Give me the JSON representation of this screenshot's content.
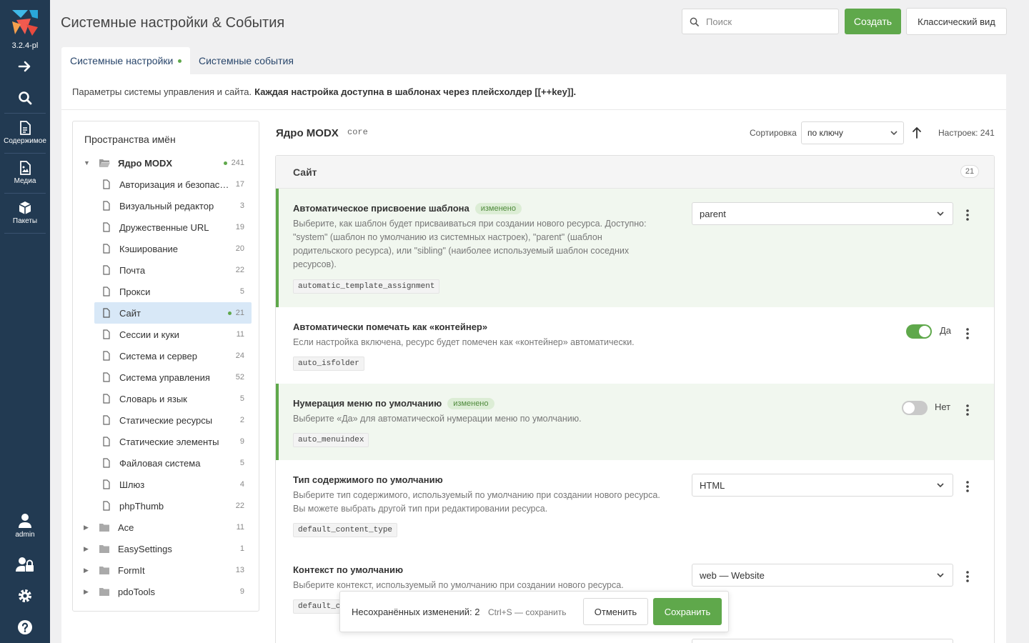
{
  "app": {
    "version": "3.2.4-pl",
    "brand_colors": {
      "sidebar": "#223a52",
      "accent": "#5fa84b",
      "link": "#29466b"
    }
  },
  "sidebar": {
    "items": [
      {
        "icon": "arrow-right-icon",
        "label": ""
      },
      {
        "icon": "search-icon",
        "label": ""
      },
      {
        "icon": "document-icon",
        "label": "Содержимое"
      },
      {
        "icon": "image-file-icon",
        "label": "Медиа"
      },
      {
        "icon": "package-icon",
        "label": "Пакеты"
      }
    ],
    "bottom": [
      {
        "icon": "user-icon",
        "label": "admin"
      },
      {
        "icon": "user-lock-icon",
        "label": ""
      },
      {
        "icon": "gear-icon",
        "label": ""
      },
      {
        "icon": "help-icon",
        "label": ""
      }
    ]
  },
  "header": {
    "title": "Системные настройки & События",
    "search_placeholder": "Поиск",
    "create_label": "Создать",
    "classic_label": "Классический вид"
  },
  "tabs": [
    {
      "label": "Системные настройки",
      "active": true,
      "modified": true
    },
    {
      "label": "Системные события",
      "active": false
    }
  ],
  "description": {
    "text": "Параметры системы управления и сайта.",
    "bold": "Каждая настройка доступна в шаблонах через плейсхолдер [[++key]]."
  },
  "namespaces": {
    "title": "Пространства имён",
    "root": {
      "label": "Ядро MODX",
      "count": "241",
      "modified": true,
      "expanded": true
    },
    "children": [
      {
        "label": "Авторизация и безопасность",
        "count": "17"
      },
      {
        "label": "Визуальный редактор",
        "count": "3"
      },
      {
        "label": "Дружественные URL",
        "count": "19"
      },
      {
        "label": "Кэширование",
        "count": "20"
      },
      {
        "label": "Почта",
        "count": "22"
      },
      {
        "label": "Прокси",
        "count": "5"
      },
      {
        "label": "Сайт",
        "count": "21",
        "selected": true,
        "modified": true
      },
      {
        "label": "Сессии и куки",
        "count": "11"
      },
      {
        "label": "Система и сервер",
        "count": "24"
      },
      {
        "label": "Система управления",
        "count": "52"
      },
      {
        "label": "Словарь и язык",
        "count": "5"
      },
      {
        "label": "Статические ресурсы",
        "count": "2"
      },
      {
        "label": "Статические элементы",
        "count": "9"
      },
      {
        "label": "Файловая система",
        "count": "5"
      },
      {
        "label": "Шлюз",
        "count": "4"
      },
      {
        "label": "phpThumb",
        "count": "22"
      }
    ],
    "others": [
      {
        "label": "Ace",
        "count": "11"
      },
      {
        "label": "EasySettings",
        "count": "1"
      },
      {
        "label": "FormIt",
        "count": "13"
      },
      {
        "label": "pdoTools",
        "count": "9"
      }
    ]
  },
  "content": {
    "title": "Ядро MODX",
    "key": "core",
    "sort_label": "Сортировка",
    "sort_value": "по ключу",
    "count_label": "Настроек: 241",
    "group": {
      "title": "Сайт",
      "count": "21"
    },
    "changed_badge": "изменено",
    "settings": [
      {
        "title": "Автоматическое присвоение шаблона",
        "changed": true,
        "desc": "Выберите, как шаблон будет присваиваться при создании нового ресурса. Доступно: \"system\" (шаблон по умолчанию из системных настроек), \"parent\" (шаблон родительского ресурса), или \"sibling\" (наиболее используемый шаблон соседних ресурсов).",
        "key": "automatic_template_assignment",
        "control": "select",
        "value": "parent"
      },
      {
        "title": "Автоматически помечать как «контейнер»",
        "changed": false,
        "desc": "Если настройка включена, ресурс будет помечен как «контейнер» автоматически.",
        "key": "auto_isfolder",
        "control": "toggle",
        "on": true,
        "value": "Да"
      },
      {
        "title": "Нумерация меню по умолчанию",
        "changed": true,
        "desc": "Выберите «Да» для автоматической нумерации меню по умолчанию.",
        "key": "auto_menuindex",
        "control": "toggle",
        "on": false,
        "value": "Нет"
      },
      {
        "title": "Тип содержимого по умолчанию",
        "changed": false,
        "desc": "Выберите тип содержимого, используемый по умолчанию при создании нового ресурса. Вы можете выбрать другой тип при редактировании ресурса.",
        "key": "default_content_type",
        "control": "select",
        "value": "HTML"
      },
      {
        "title": "Контекст по умолчанию",
        "changed": false,
        "desc": "Выберите контекст, используемый по умолчанию при создании нового ресурса.",
        "key": "default_context",
        "control": "select",
        "value": "web — Website"
      }
    ]
  },
  "unsaved": {
    "text": "Несохранённых изменений: 2",
    "hint": "Ctrl+S — сохранить",
    "cancel_label": "Отменить",
    "save_label": "Сохранить"
  }
}
